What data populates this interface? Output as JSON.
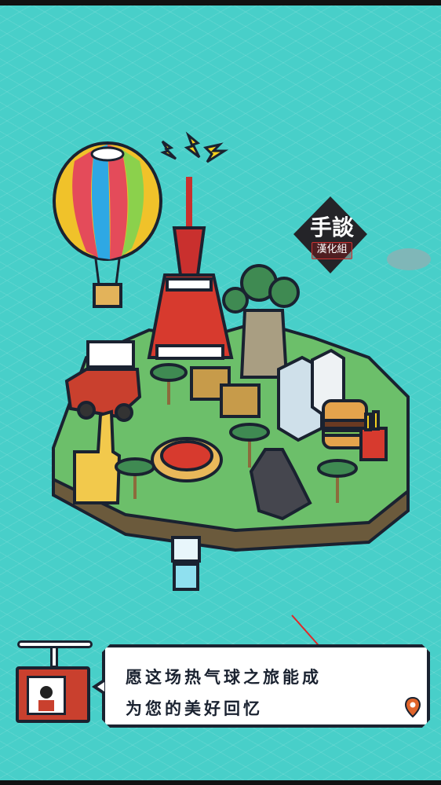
{
  "watermark": {
    "title": "手談",
    "subtitle": "漢化組"
  },
  "dialog": {
    "line1": "愿这场热气球之旅能成",
    "line2": "为您的美好回忆"
  },
  "icons": {
    "location": "location-pin-icon",
    "balloon": "hot-air-balloon-icon",
    "tower": "tokyo-tower-icon",
    "tv": "tv-host-icon"
  },
  "colors": {
    "background": "#48cfc9",
    "outline": "#1a2230",
    "accent_red": "#c9402e",
    "grass": "#6cbf6a"
  }
}
